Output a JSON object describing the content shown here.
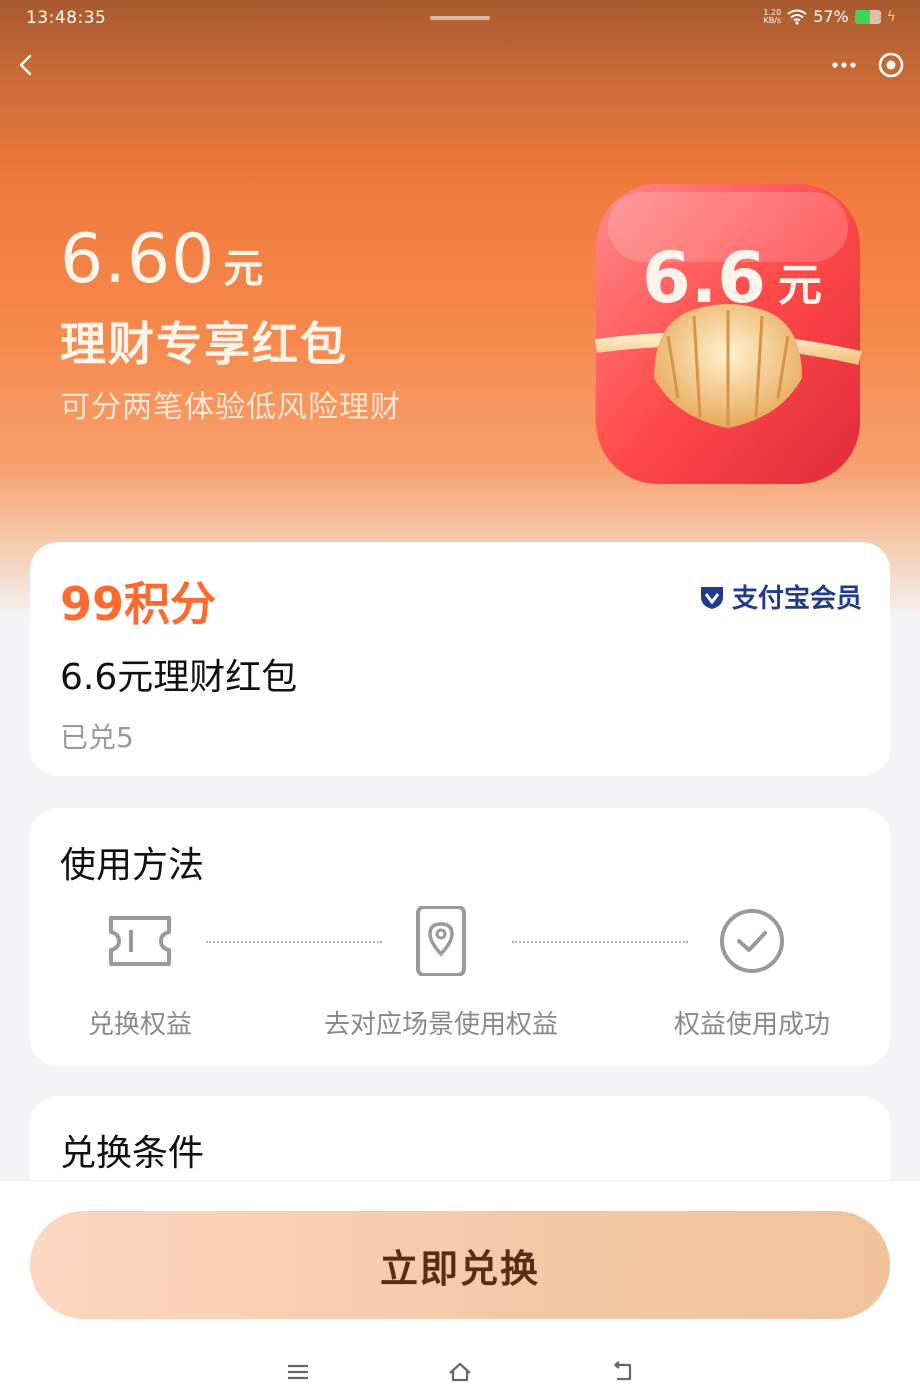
{
  "status": {
    "time": "13:48:35",
    "net_speed_top": "1.20",
    "net_speed_bottom": "KB/s",
    "battery": "57%"
  },
  "hero": {
    "amount": "6.60",
    "unit": "元",
    "title": "理财专享红包",
    "subtitle": "可分两笔体验低风险理财",
    "packet_amount": "6.6",
    "packet_unit": "元"
  },
  "product": {
    "points": "99积分",
    "brand": "支付宝会员",
    "name": "6.6元理财红包",
    "redeemed": "已兑5"
  },
  "usage": {
    "title": "使用方法",
    "steps": [
      {
        "label": "兑换权益",
        "icon": "ticket-icon"
      },
      {
        "label": "去对应场景使用权益",
        "icon": "phone-location-icon"
      },
      {
        "label": "权益使用成功",
        "icon": "check-circle-icon"
      }
    ]
  },
  "conditions": {
    "title": "兑换条件"
  },
  "footer": {
    "redeem_label": "立即兑换"
  },
  "colors": {
    "accent": "#ff6a2e",
    "brand": "#1f3b8a",
    "button": "#f5c9a7"
  }
}
